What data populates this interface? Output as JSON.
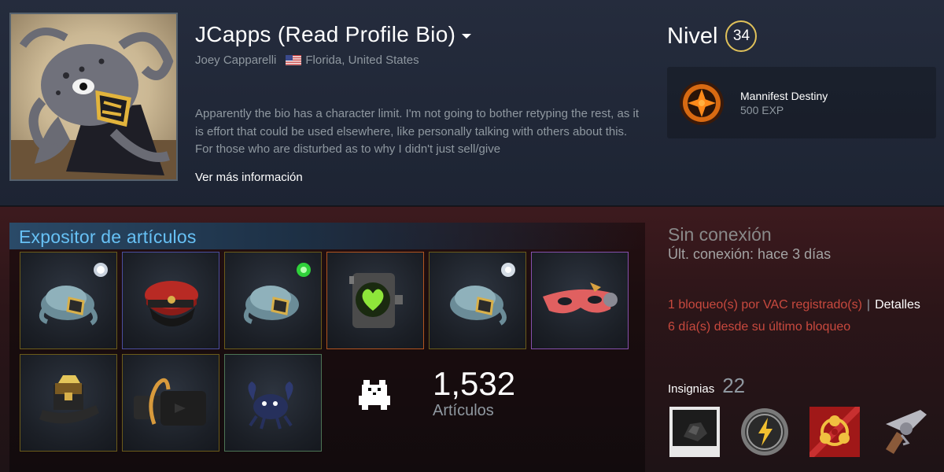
{
  "profile": {
    "persona_name": "JCapps (Read Profile Bio)",
    "real_name": "Joey Capparelli",
    "location": "Florida, United States",
    "flag": "us-flag-icon",
    "bio": "Apparently the bio has a character limit. I'm not going to bother retyping the rest, as it is effort that could be used elsewhere, like personally talking with others about this. For those who are disturbed as to why I didn't just sell/give",
    "more_info_link": "Ver más información"
  },
  "level": {
    "label": "Nivel",
    "value": "34"
  },
  "favorite_badge": {
    "name": "Mannifest Destiny",
    "xp": "500 EXP",
    "icon": "mannifest-destiny-badge-icon"
  },
  "showcase": {
    "title": "Expositor de artículos",
    "items": [
      {
        "icon": "octopus-hat-icon",
        "quality_color": "#7d6d00"
      },
      {
        "icon": "officer-cap-icon",
        "quality_color": "#5a4aa0"
      },
      {
        "icon": "octopus-hat-icon",
        "quality_color": "#7d6d00"
      },
      {
        "icon": "heart-device-icon",
        "quality_color": "#b2541f"
      },
      {
        "icon": "octopus-hat-icon",
        "quality_color": "#7d6d00"
      },
      {
        "icon": "red-mask-icon",
        "quality_color": "#8650ac"
      },
      {
        "icon": "treasure-hat-icon",
        "quality_color": "#7d6d00"
      },
      {
        "icon": "belt-bag-icon",
        "quality_color": "#7d6d00"
      },
      {
        "icon": "blue-crab-icon",
        "quality_color": "#4d7455"
      }
    ],
    "item_count": "1,532",
    "item_count_label": "Artículos",
    "count_icon": "white-dog-icon"
  },
  "status": {
    "state": "Sin conexión",
    "last_online": "Últ. conexión: hace 3 días"
  },
  "bans": {
    "vac_text": "1 bloqueo(s) por VAC registrado(s)",
    "separator": "|",
    "details_link": "Detalles",
    "days_since": "6 día(s) desde su último bloqueo"
  },
  "badges": {
    "title": "Insignias",
    "count": "22",
    "items": [
      {
        "icon": "coal-polaroid-badge-icon"
      },
      {
        "icon": "lightning-coin-badge-icon"
      },
      {
        "icon": "biohazard-badge-icon"
      },
      {
        "icon": "revolver-badge-icon"
      }
    ]
  },
  "colors": {
    "accent_blue": "#67c1f5",
    "level_ring": "#e0c15a",
    "ban_red": "#c8493e"
  }
}
